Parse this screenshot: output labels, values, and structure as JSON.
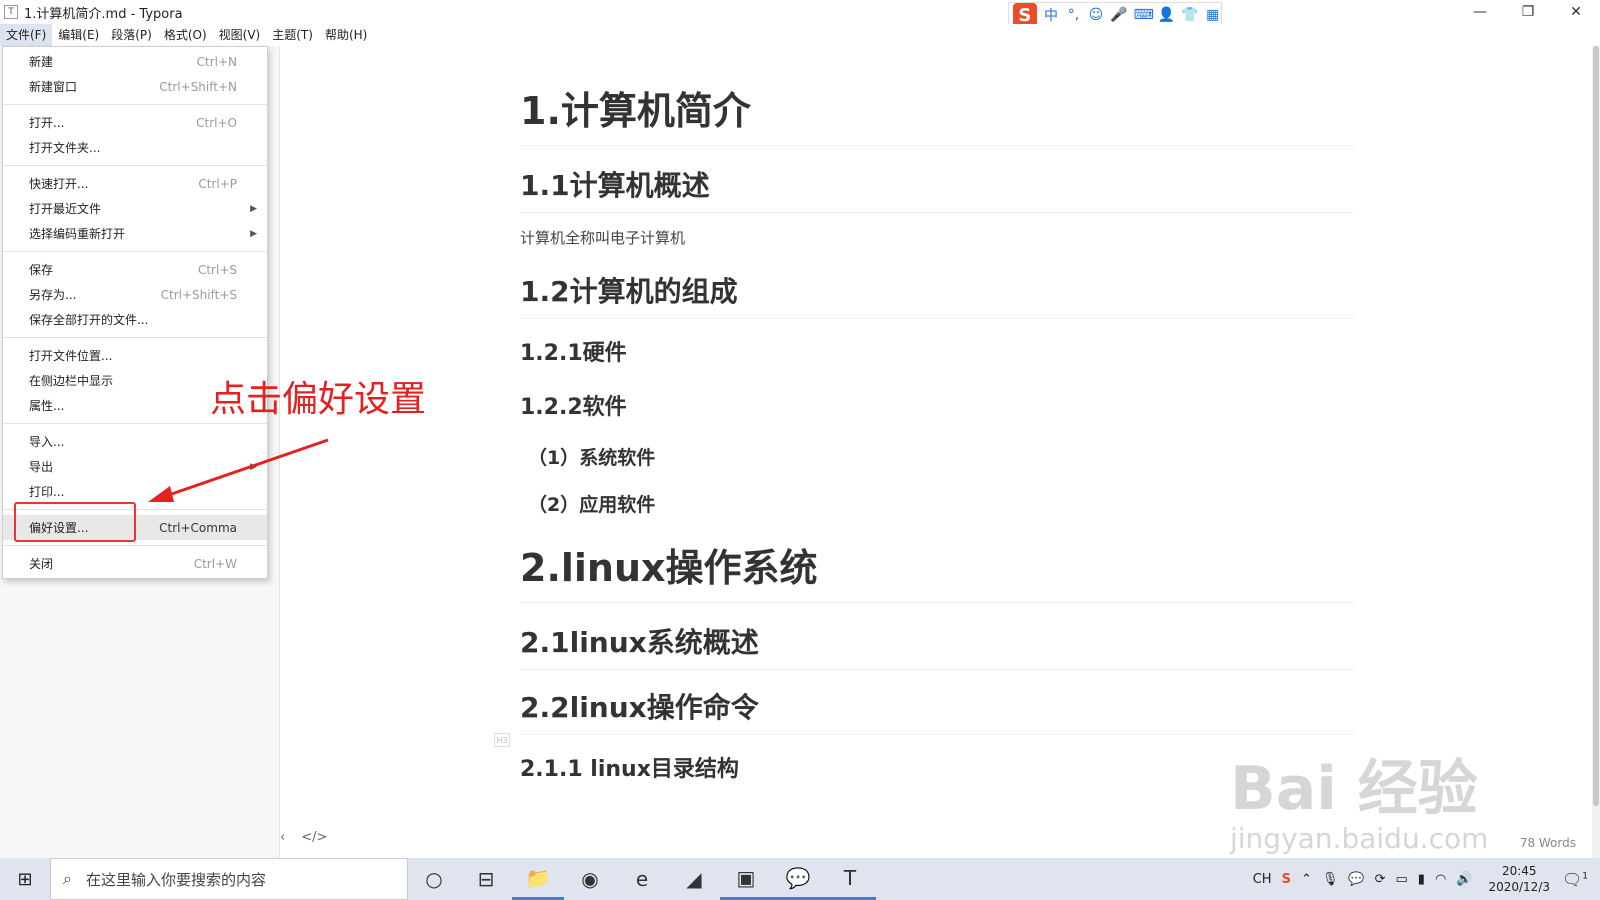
{
  "window": {
    "title": "1.计算机简介.md - Typora",
    "app_icon": "T"
  },
  "ime": {
    "logo": "S",
    "items": [
      "中",
      "°,",
      "☺",
      "🎤",
      "⌨",
      "👤",
      "👕",
      "▦"
    ]
  },
  "menubar": [
    "文件(F)",
    "编辑(E)",
    "段落(P)",
    "格式(O)",
    "视图(V)",
    "主题(T)",
    "帮助(H)"
  ],
  "file_menu": {
    "groups": [
      [
        {
          "label": "新建",
          "shortcut": "Ctrl+N"
        },
        {
          "label": "新建窗口",
          "shortcut": "Ctrl+Shift+N"
        }
      ],
      [
        {
          "label": "打开...",
          "shortcut": "Ctrl+O"
        },
        {
          "label": "打开文件夹...",
          "shortcut": ""
        }
      ],
      [
        {
          "label": "快速打开...",
          "shortcut": "Ctrl+P"
        },
        {
          "label": "打开最近文件",
          "shortcut": "",
          "submenu": true
        },
        {
          "label": "选择编码重新打开",
          "shortcut": "",
          "submenu": true
        }
      ],
      [
        {
          "label": "保存",
          "shortcut": "Ctrl+S"
        },
        {
          "label": "另存为...",
          "shortcut": "Ctrl+Shift+S"
        },
        {
          "label": "保存全部打开的文件...",
          "shortcut": ""
        }
      ],
      [
        {
          "label": "打开文件位置...",
          "shortcut": ""
        },
        {
          "label": "在侧边栏中显示",
          "shortcut": ""
        },
        {
          "label": "属性...",
          "shortcut": ""
        }
      ],
      [
        {
          "label": "导入...",
          "shortcut": ""
        },
        {
          "label": "导出",
          "shortcut": "",
          "submenu": true
        },
        {
          "label": "打印...",
          "shortcut": ""
        }
      ],
      [
        {
          "label": "偏好设置...",
          "shortcut": "Ctrl+Comma",
          "highlighted": true
        }
      ],
      [
        {
          "label": "关闭",
          "shortcut": "Ctrl+W"
        }
      ]
    ]
  },
  "annotation": {
    "text": "点击偏好设置",
    "color": "#e52020"
  },
  "document": [
    {
      "type": "h1",
      "text": "1.计算机简介"
    },
    {
      "type": "h2",
      "text": "1.1计算机概述"
    },
    {
      "type": "p",
      "text": "计算机全称叫电子计算机"
    },
    {
      "type": "h2",
      "text": "1.2计算机的组成"
    },
    {
      "type": "h3",
      "text": "1.2.1硬件"
    },
    {
      "type": "h3",
      "text": "1.2.2软件"
    },
    {
      "type": "h4",
      "text": "（1）系统软件"
    },
    {
      "type": "h4",
      "text": "（2）应用软件"
    },
    {
      "type": "h1big",
      "text": "2.linux操作系统"
    },
    {
      "type": "h2",
      "text": "2.1linux系统概述"
    },
    {
      "type": "h2",
      "text": "2.2linux操作命令"
    },
    {
      "type": "h3",
      "text": "2.1.1 linux目录结构"
    }
  ],
  "md_tag": "H3",
  "status": {
    "word_count": "78 Words",
    "outline_toggle": "‹",
    "source_toggle": "</>"
  },
  "watermark": {
    "line1": "Bai 经验",
    "line2": "jingyan.baidu.com"
  },
  "taskbar": {
    "start_icon": "⊞",
    "search_placeholder": "在这里输入你要搜索的内容",
    "icons": [
      "○",
      "⊟",
      "📁",
      "◉",
      "e",
      "◢",
      "▣",
      "💬",
      "T"
    ],
    "tray_lang": "CH",
    "time": "20:45",
    "date": "2020/12/3",
    "notif_count": "1"
  }
}
